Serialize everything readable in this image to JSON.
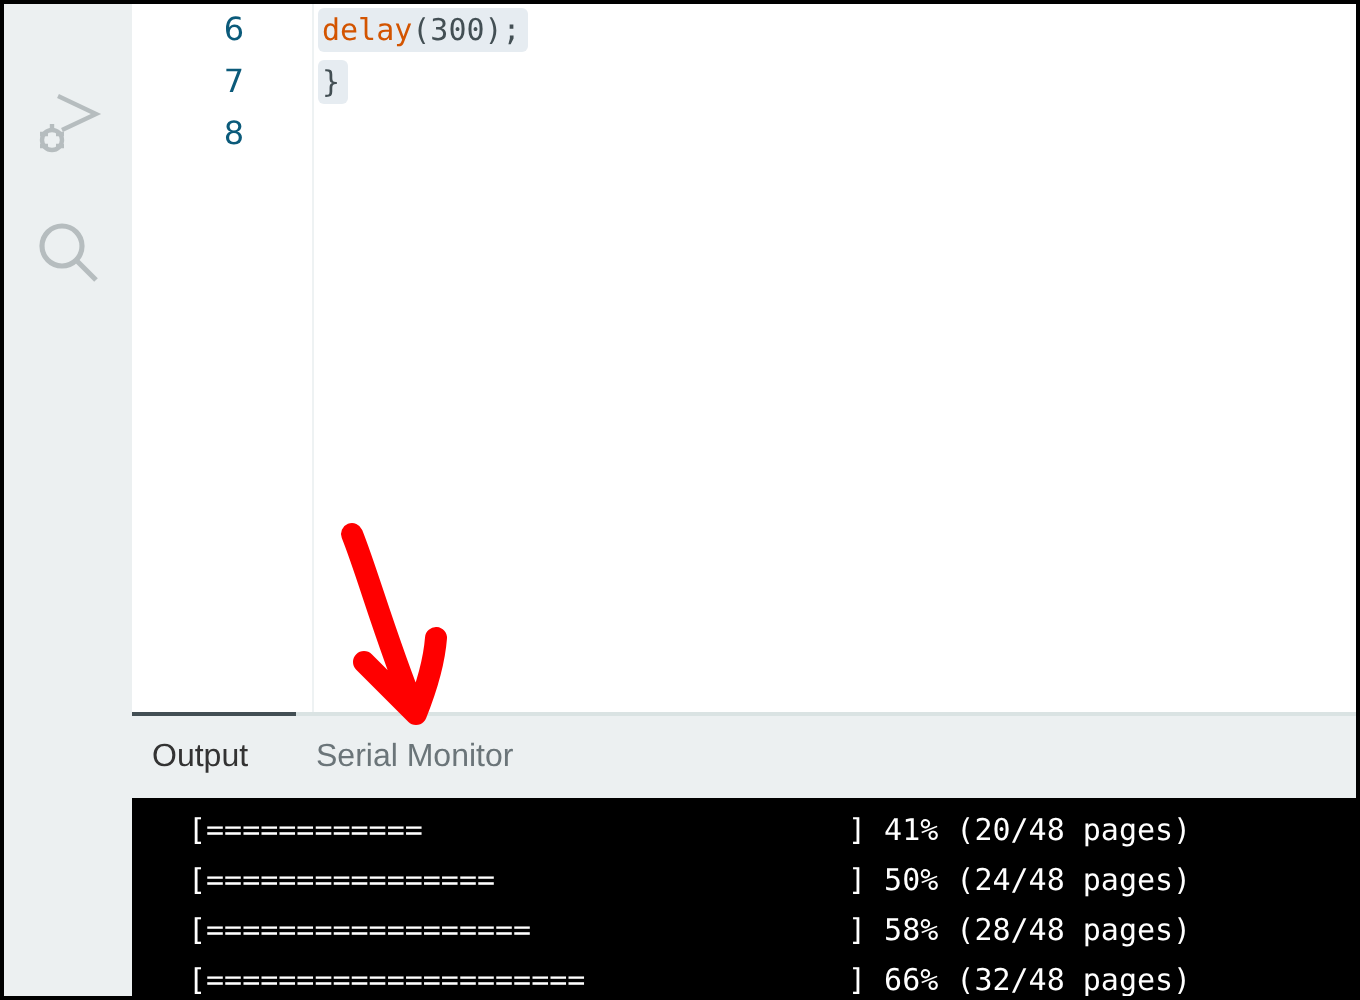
{
  "activity_bar": {
    "items": [
      {
        "kind": "debug",
        "selected": false
      },
      {
        "kind": "search",
        "selected": false
      }
    ]
  },
  "editor": {
    "lines": [
      {
        "number": "6",
        "tokens": [
          {
            "kind": "function",
            "text": "delay"
          },
          {
            "kind": "plain",
            "text": "(300);"
          }
        ]
      },
      {
        "number": "7",
        "tokens": [
          {
            "kind": "plain",
            "text": "}"
          }
        ]
      },
      {
        "number": "8"
      }
    ]
  },
  "panel": {
    "tabs": [
      {
        "label": "Output",
        "selected": true
      },
      {
        "label": "Serial Monitor",
        "selected": false
      }
    ],
    "output": [
      {
        "bar": "[============",
        "progress": "] 41% (20/48 pages)"
      },
      {
        "bar": "[================",
        "progress": "] 50% (24/48 pages)"
      },
      {
        "bar": "[==================",
        "progress": "] 58% (28/48 pages)"
      },
      {
        "bar": "[=====================",
        "progress": "] 66% (32/48 pages)"
      }
    ]
  }
}
